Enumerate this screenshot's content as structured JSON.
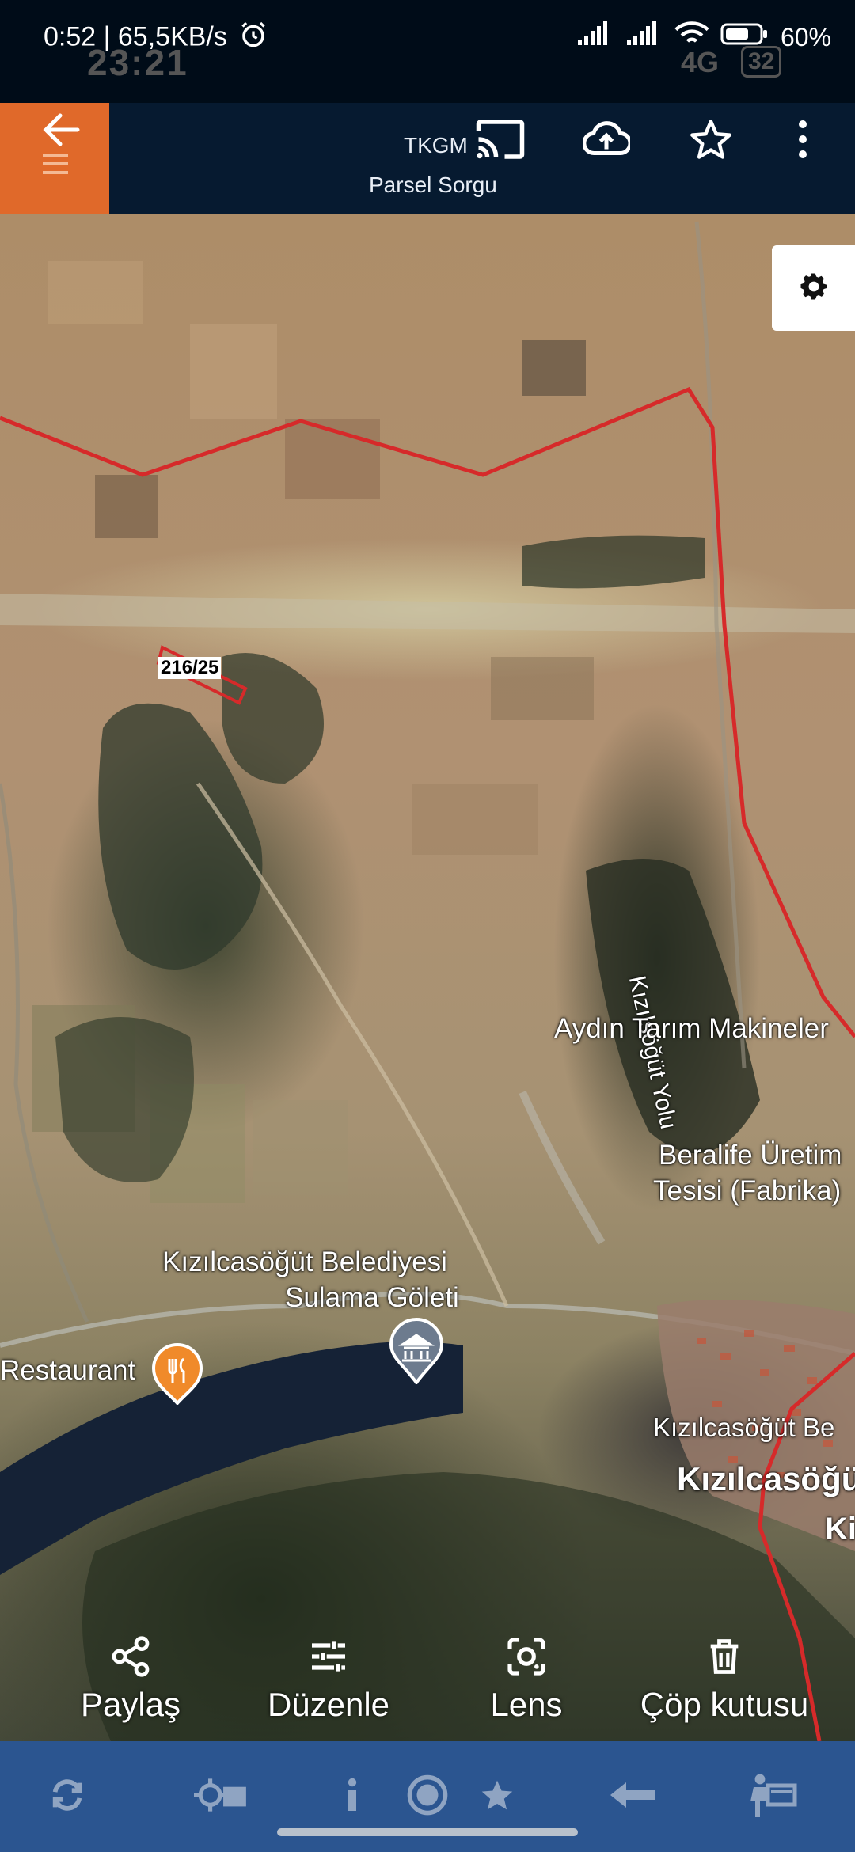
{
  "status_bar": {
    "left_text": "0:52 | 65,5KB/s",
    "ghost_time": "23:21",
    "network": "4G",
    "ghost_badge": "32",
    "battery": "60%"
  },
  "app_bar": {
    "title_line1": "TKGM",
    "title_line2": "Parsel Sorgu",
    "accent_color": "#e0692a",
    "icons": [
      "back-arrow-icon",
      "cast-icon",
      "cloud-upload-icon",
      "star-icon",
      "more-vert-icon"
    ]
  },
  "map": {
    "parcel_label": "216/25",
    "road_label": "Kızılsöğüt Yolu",
    "labels": {
      "aydin": "Aydın Tarım Makineler",
      "beralife1": "Beralife Üretim",
      "beralife2": "Tesisi (Fabrika)",
      "belediye1": "Kızılcasöğüt Belediyesi",
      "belediye2": "Sulama Göleti",
      "restaurant": "Restaurant",
      "kizilca_be": "Kızılcasöğüt Be",
      "kizilca_big": "Kızılcasöğü",
      "ki": "Ki"
    },
    "boundary_color": "#d62a2a"
  },
  "actions": {
    "share": "Paylaş",
    "edit": "Düzenle",
    "lens": "Lens",
    "trash": "Çöp kutusu"
  },
  "toolbar": {
    "icons": [
      "refresh-icon",
      "gps-layer-icon",
      "info-icon",
      "record-icon",
      "star-icon",
      "swap-arrow-icon",
      "measure-person-icon"
    ]
  }
}
